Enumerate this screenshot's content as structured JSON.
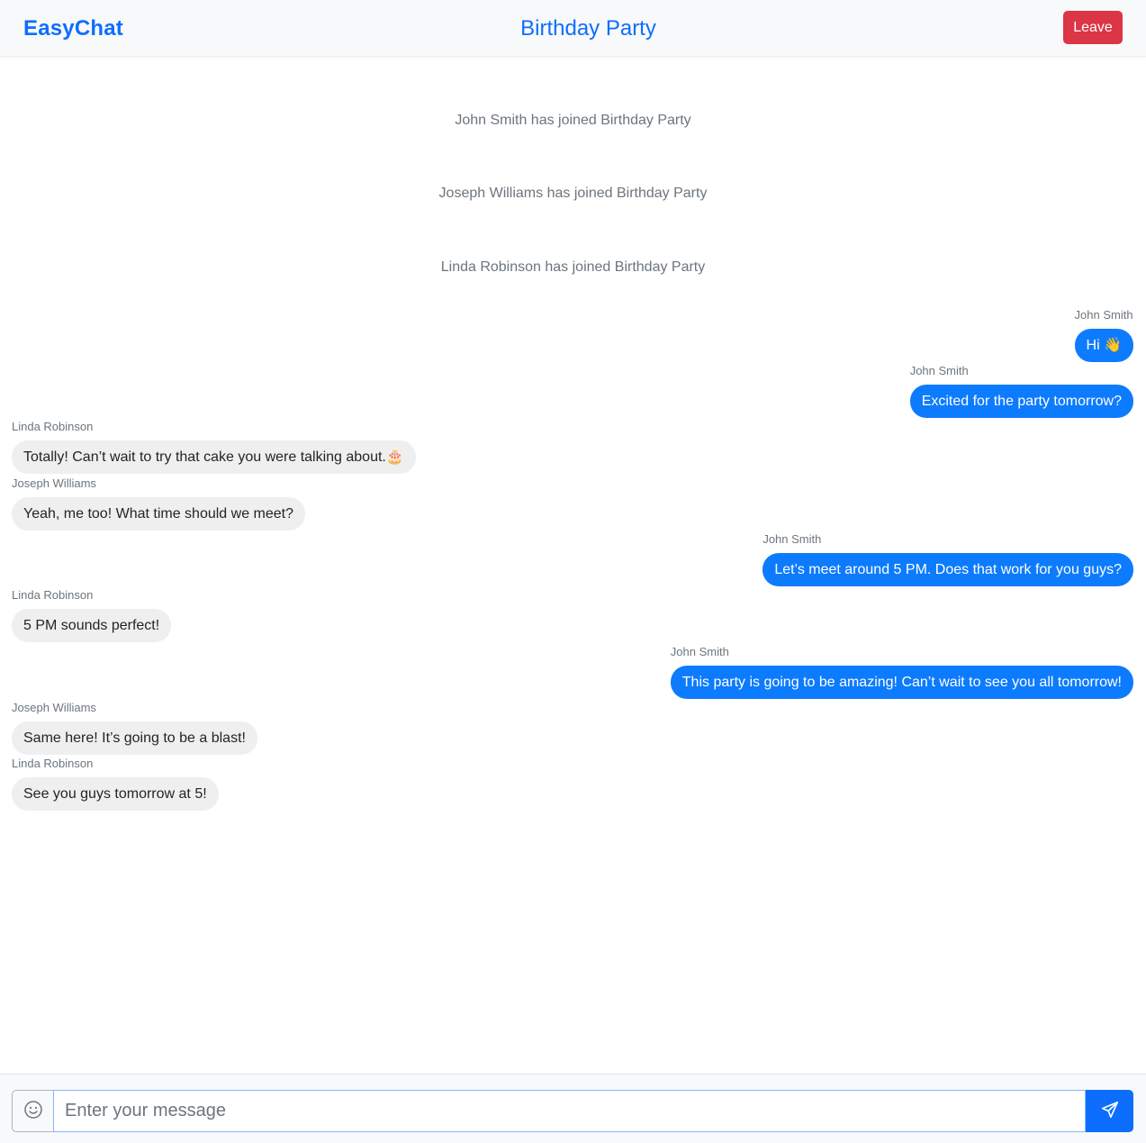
{
  "header": {
    "brand": "EasyChat",
    "room_title": "Birthday Party",
    "leave_label": "Leave"
  },
  "system_messages": [
    "John Smith has joined Birthday Party",
    "Joseph Williams has joined Birthday Party",
    "Linda Robinson has joined Birthday Party"
  ],
  "messages": [
    {
      "sender": "John Smith",
      "text": "Hi 👋",
      "side": "right"
    },
    {
      "sender": "John Smith",
      "text": "Excited for the party tomorrow?",
      "side": "right"
    },
    {
      "sender": "Linda Robinson",
      "text": "Totally! Can’t wait to try that cake you were talking about.🎂",
      "side": "left"
    },
    {
      "sender": "Joseph Williams",
      "text": "Yeah, me too! What time should we meet?",
      "side": "left"
    },
    {
      "sender": "John Smith",
      "text": "Let’s meet around 5 PM. Does that work for you guys?",
      "side": "right"
    },
    {
      "sender": "Linda Robinson",
      "text": "5 PM sounds perfect!",
      "side": "left"
    },
    {
      "sender": "John Smith",
      "text": "This party is going to be amazing! Can’t wait to see you all tomorrow!",
      "side": "right"
    },
    {
      "sender": "Joseph Williams",
      "text": "Same here! It’s going to be a blast!",
      "side": "left"
    },
    {
      "sender": "Linda Robinson",
      "text": "See you guys tomorrow at 5!",
      "side": "left"
    }
  ],
  "composer": {
    "placeholder": "Enter your message",
    "emoji_icon": "smiley-icon",
    "send_icon": "paper-plane-icon"
  },
  "colors": {
    "accent": "#0d6efd",
    "danger": "#dc3545",
    "outgoing_bubble": "#0d7bfd",
    "incoming_bubble": "#efefef"
  }
}
